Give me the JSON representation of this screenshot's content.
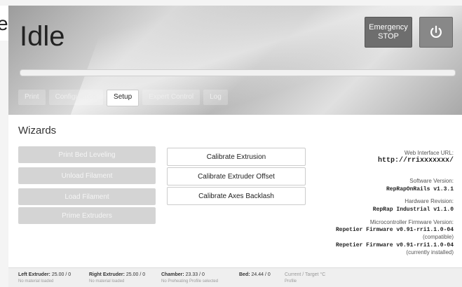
{
  "edge_letter": "e",
  "header": {
    "status_title": "Idle",
    "estop_line1": "Emergency",
    "estop_line2": "STOP",
    "progress_fraction": 0.0
  },
  "tabs": [
    {
      "label": "Print",
      "active": false
    },
    {
      "label": "Configuration",
      "active": false
    },
    {
      "label": "Setup",
      "active": true
    },
    {
      "label": "Expert Control",
      "active": false
    },
    {
      "label": "Log",
      "active": false
    }
  ],
  "wizards": {
    "title": "Wizards",
    "left_buttons": [
      "Print Bed Leveling",
      "Unload Filament",
      "Load Filament",
      "Prime Extruders"
    ],
    "right_buttons": [
      "Calibrate Extrusion",
      "Calibrate Extruder Offset",
      "Calibrate Axes Backlash"
    ]
  },
  "info": {
    "web_url_label": "Web Interface URL:",
    "web_url_value": "http://rrixxxxxxx/",
    "software_label": "Software Version:",
    "software_value": "RepRapOnRails v1.3.1",
    "hardware_label": "Hardware Revision:",
    "hardware_value": "RepRap Industrial v1.1.0",
    "firmware_label": "Microcontroller Firmware Version:",
    "firmware_compatible_value": "Repetier Firmware v0.91-rri1.1.0-04",
    "firmware_compatible_note": "(compatible)",
    "firmware_installed_value": "Repetier Firmware v0.91-rri1.1.0-04",
    "firmware_installed_note": "(currently installed)"
  },
  "footer": {
    "left_extruder_label": "Left Extruder:",
    "left_extruder_value": "25.00 / 0",
    "left_extruder_sub": "No material loaded",
    "right_extruder_label": "Right Extruder:",
    "right_extruder_value": "25.00 / 0",
    "right_extruder_sub": "No material loaded",
    "chamber_label": "Chamber:",
    "chamber_value": "23.33 / 0",
    "chamber_sub": "No Preheating Profile selected",
    "bed_label": "Bed:",
    "bed_value": "24.44 / 0",
    "legend": "Current / Target °C",
    "legend_sub": "Profile"
  },
  "colors": {
    "progress_fill": "#5fa8d3",
    "estop_bg": "#6e6e6e",
    "disabled_button_bg": "#d4d4d4"
  }
}
